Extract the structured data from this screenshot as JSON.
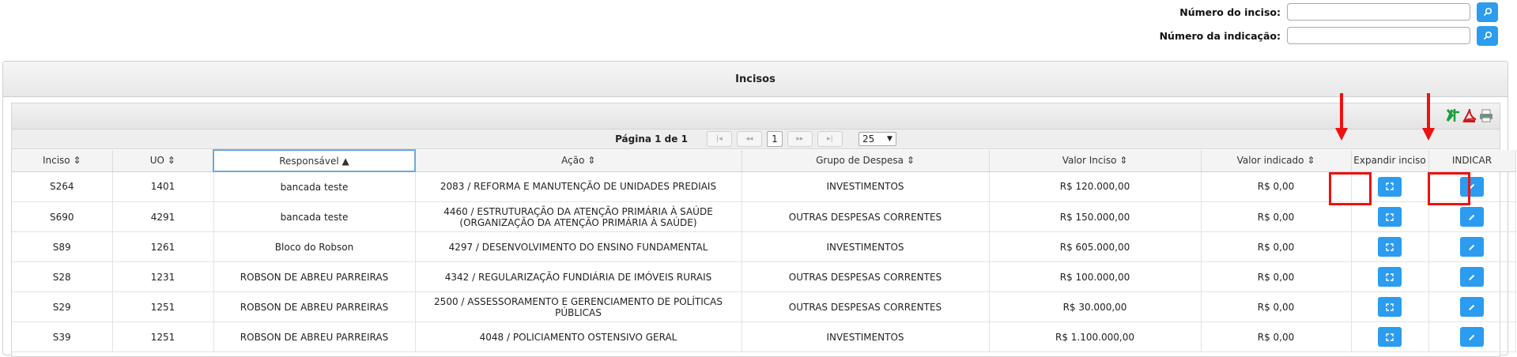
{
  "filters": {
    "inciso_label": "Número do inciso:",
    "indicacao_label": "Número da indicação:",
    "inciso_value": "",
    "indicacao_value": ""
  },
  "panel": {
    "title": "Incisos"
  },
  "pager": {
    "text": "Página 1 de 1",
    "current_page": "1",
    "page_size": "25"
  },
  "columns": [
    "Inciso",
    "UO",
    "Responsável",
    "Ação",
    "Grupo de Despesa",
    "Valor Inciso",
    "Valor indicado",
    "Expandir inciso",
    "INDICAR"
  ],
  "rows": [
    {
      "inciso": "S264",
      "uo": "1401",
      "responsavel": "bancada teste",
      "acao": "2083 / REFORMA E MANUTENÇÃO DE UNIDADES PREDIAIS",
      "grupo": "INVESTIMENTOS",
      "valor_inciso": "R$ 120.000,00",
      "valor_indicado": "R$ 0,00"
    },
    {
      "inciso": "S690",
      "uo": "4291",
      "responsavel": "bancada teste",
      "acao": "4460 / ESTRUTURAÇÃO DA ATENÇÃO PRIMÁRIA À SAÚDE (ORGANIZAÇÃO DA ATENÇÃO PRIMÁRIA À SAÚDE)",
      "grupo": "OUTRAS DESPESAS CORRENTES",
      "valor_inciso": "R$ 150.000,00",
      "valor_indicado": "R$ 0,00"
    },
    {
      "inciso": "S89",
      "uo": "1261",
      "responsavel": "Bloco do Robson",
      "acao": "4297 / DESENVOLVIMENTO DO ENSINO FUNDAMENTAL",
      "grupo": "INVESTIMENTOS",
      "valor_inciso": "R$ 605.000,00",
      "valor_indicado": "R$ 0,00"
    },
    {
      "inciso": "S28",
      "uo": "1231",
      "responsavel": "ROBSON DE ABREU PARREIRAS",
      "acao": "4342 / REGULARIZAÇÃO FUNDIÁRIA DE IMÓVEIS RURAIS",
      "grupo": "OUTRAS DESPESAS CORRENTES",
      "valor_inciso": "R$ 100.000,00",
      "valor_indicado": "R$ 0,00"
    },
    {
      "inciso": "S29",
      "uo": "1251",
      "responsavel": "ROBSON DE ABREU PARREIRAS",
      "acao": "2500 / ASSESSORAMENTO E GERENCIAMENTO DE POLÍTICAS PÚBLICAS",
      "grupo": "OUTRAS DESPESAS CORRENTES",
      "valor_inciso": "R$ 30.000,00",
      "valor_indicado": "R$ 0,00"
    },
    {
      "inciso": "S39",
      "uo": "1251",
      "responsavel": "ROBSON DE ABREU PARREIRAS",
      "acao": "4048 / POLICIAMENTO OSTENSIVO GERAL",
      "grupo": "INVESTIMENTOS",
      "valor_inciso": "R$ 1.100.000,00",
      "valor_indicado": "R$ 0,00"
    }
  ],
  "icons": {
    "search": "search-icon",
    "export_excel": "excel-export-icon",
    "export_pdf": "pdf-export-icon",
    "print": "print-icon",
    "expand": "expand-icon",
    "indicate": "edit-icon"
  },
  "colors": {
    "accent": "#2b9cf0",
    "annotation": "#ee1111"
  }
}
